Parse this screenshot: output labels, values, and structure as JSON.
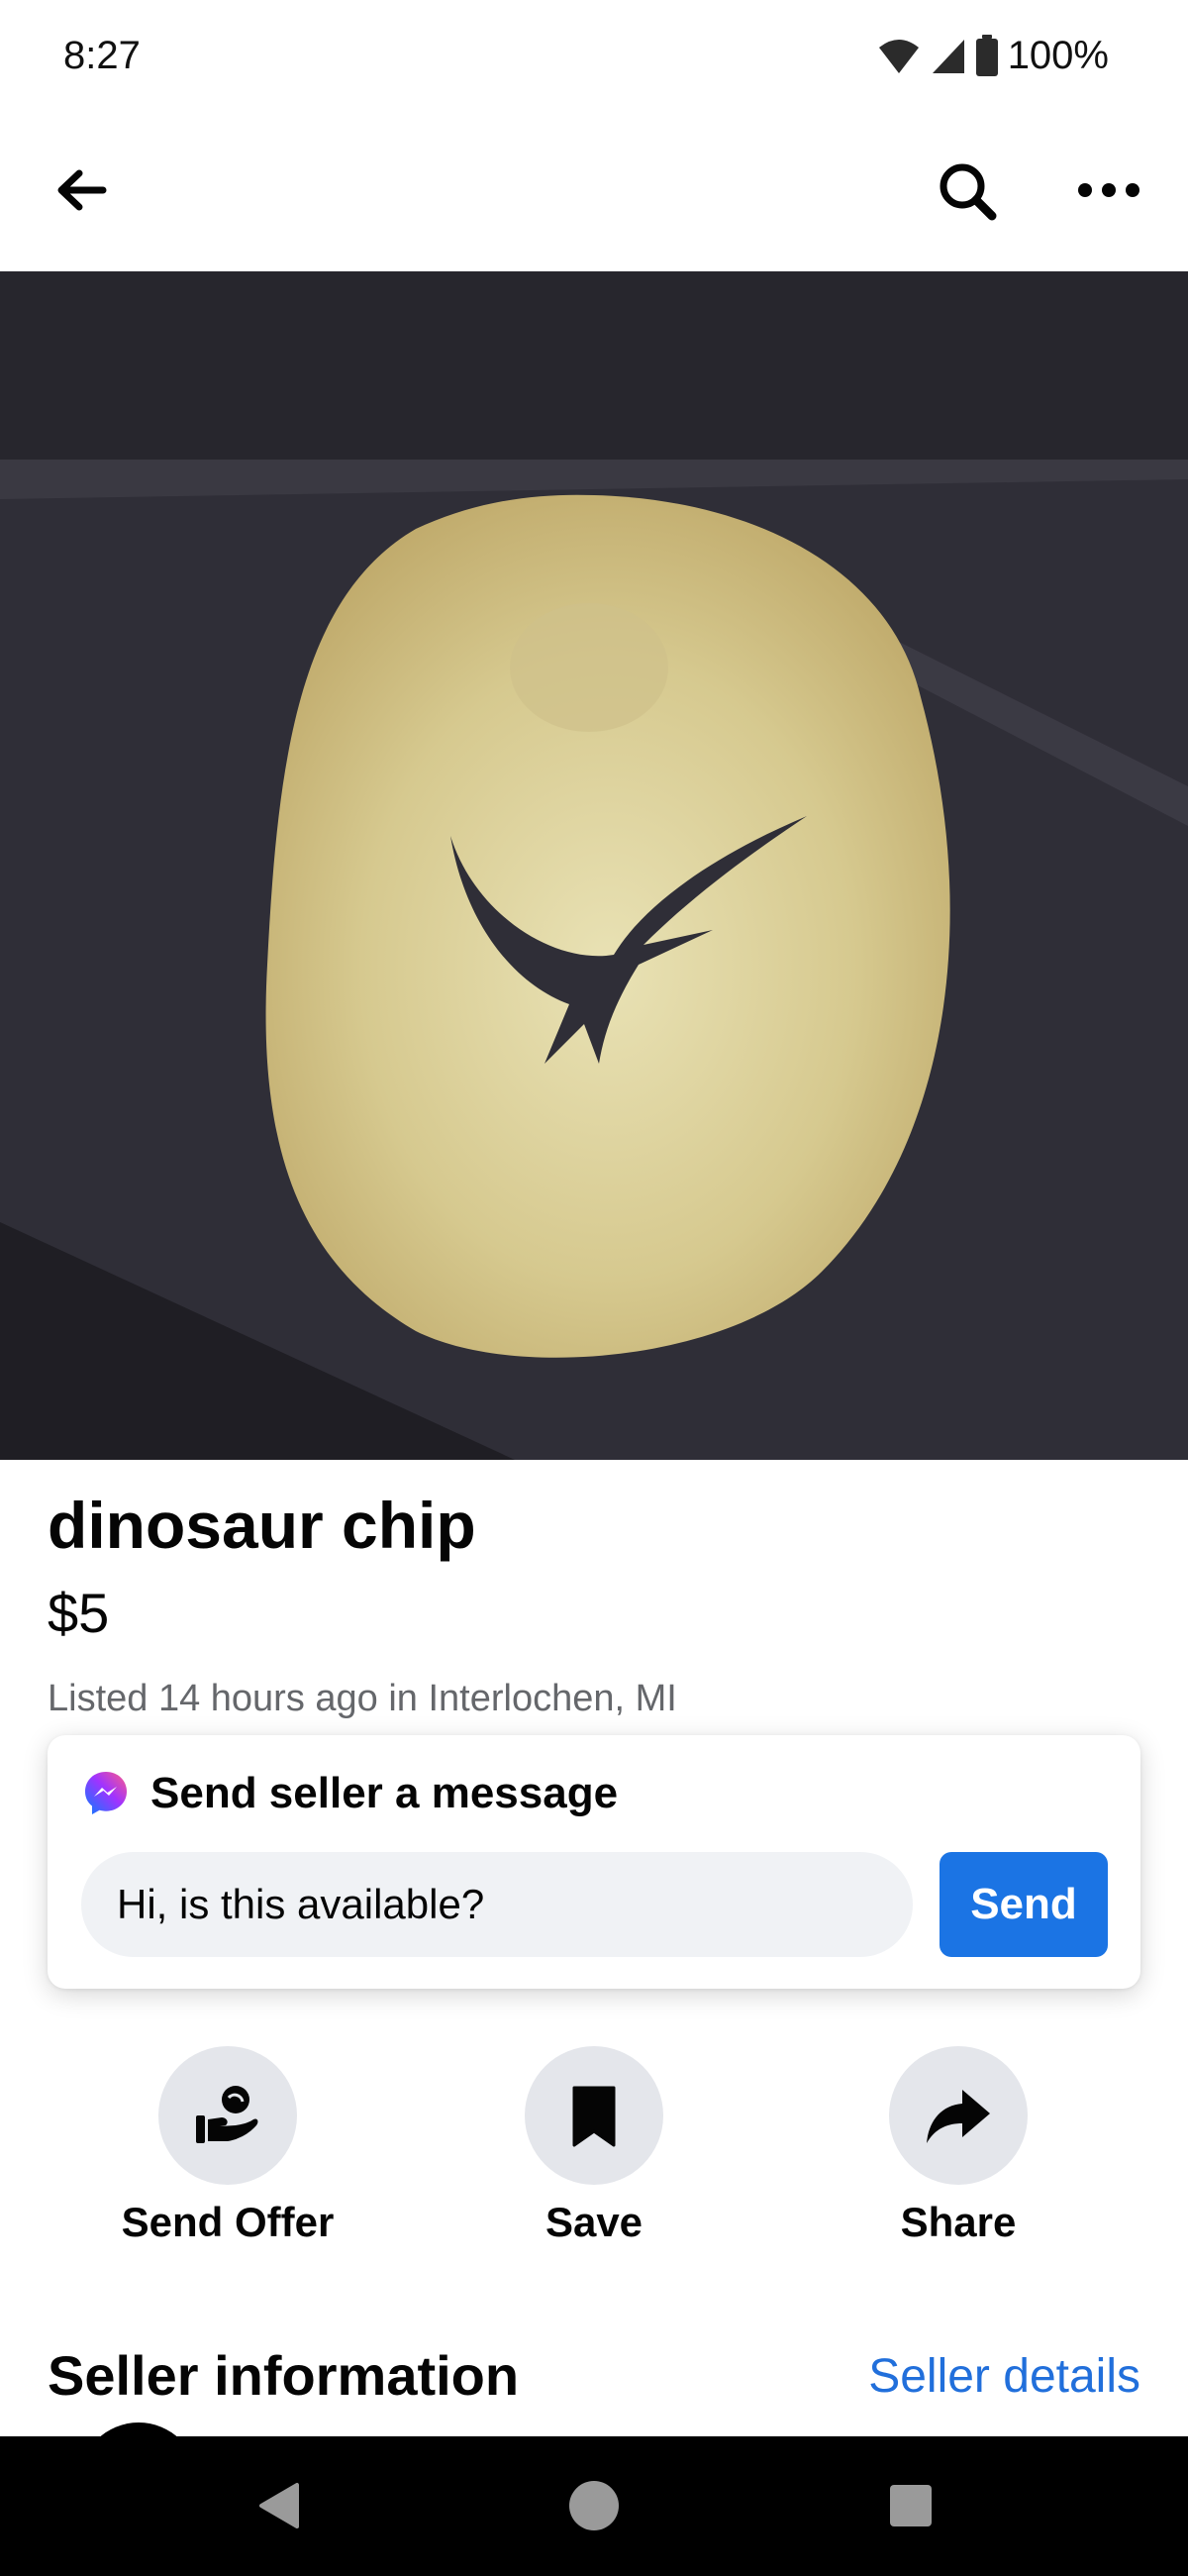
{
  "status_bar": {
    "time": "8:27",
    "battery": "100%",
    "icons": [
      "wifi-icon",
      "signal-icon",
      "battery-icon"
    ]
  },
  "top_nav": {
    "icons": [
      "back-arrow-icon",
      "search-icon",
      "more-options-icon"
    ]
  },
  "listing": {
    "title": "dinosaur chip",
    "price": "$5",
    "listed": "Listed 14 hours ago in Interlochen, MI"
  },
  "message": {
    "header": "Send seller a message",
    "input_value": "Hi, is this available?",
    "send_label": "Send"
  },
  "actions": [
    {
      "label": "Send Offer",
      "icon": "send-offer-icon"
    },
    {
      "label": "Save",
      "icon": "bookmark-icon"
    },
    {
      "label": "Share",
      "icon": "share-arrow-icon"
    }
  ],
  "seller": {
    "title": "Seller information",
    "link": "Seller details"
  },
  "colors": {
    "accent": "#1b74e4",
    "link": "#216fdb",
    "secondary_text": "#65676b",
    "button_bg": "#e4e6eb"
  }
}
